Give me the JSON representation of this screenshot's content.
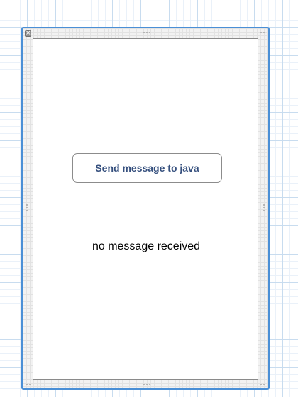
{
  "window": {
    "close_glyph": "×"
  },
  "content": {
    "button_label": "Send message to java",
    "message_text": "no message received"
  },
  "colors": {
    "selection_border": "#4a8fd6",
    "button_text": "#36507e",
    "background_grid": "#c8dcef"
  },
  "icons": {
    "close": "close-icon",
    "resize_handle": "resize-handle"
  }
}
